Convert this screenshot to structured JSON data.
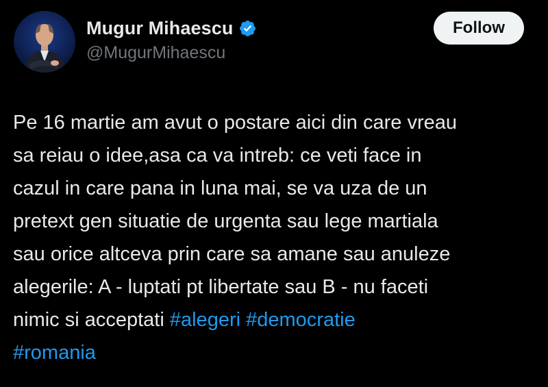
{
  "author": {
    "display_name": "Mugur Mihaescu",
    "handle": "@MugurMihaescu",
    "verified": true,
    "avatar_icon": "profile-photo"
  },
  "follow_button": {
    "label": "Follow"
  },
  "tweet": {
    "text": "Pe 16 martie am avut o postare aici din care vreau\nsa reiau o idee,asa ca va intreb: ce veti face in\ncazul in care pana in luna mai, se va uza de un\npretext gen situatie de urgenta sau lege martiala\nsau orice altceva prin care sa amane sau anuleze\nalegerile: A - luptati pt libertate sau B - nu faceti\nnimic si acceptati ",
    "hashtags": [
      "#alegeri",
      "#democratie",
      "#romania"
    ]
  },
  "colors": {
    "background": "#000000",
    "text": "#e7e9ea",
    "secondary_text": "#71767b",
    "link": "#1d9bf0",
    "verified_badge": "#1d9bf0",
    "follow_button_bg": "#eff3f4"
  }
}
